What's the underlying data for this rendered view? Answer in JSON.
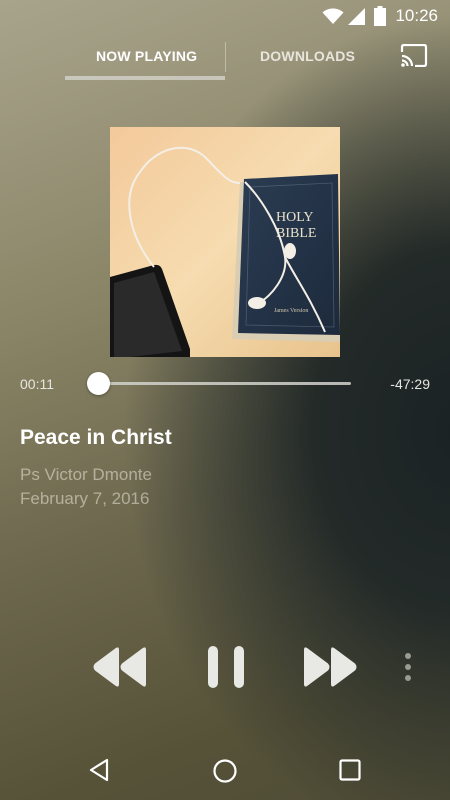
{
  "status_bar": {
    "time": "10:26",
    "icons": [
      "wifi-icon",
      "cellular-signal-icon",
      "battery-icon"
    ]
  },
  "tabs": [
    {
      "label": "NOW PLAYING",
      "selected": true
    },
    {
      "label": "DOWNLOADS",
      "selected": false
    }
  ],
  "header_actions": {
    "cast_icon": "cast-icon"
  },
  "album_art": {
    "description_icon": "album-art-image",
    "cover_text": [
      "HOLY",
      "BIBLE"
    ],
    "spine_text": "James Version"
  },
  "player": {
    "elapsed": "00:11",
    "remaining": "-47:29",
    "progress_fraction": 0.004
  },
  "track": {
    "title": "Peace in Christ",
    "artist": "Ps Victor Dmonte",
    "date": "February 7, 2016"
  },
  "controls": [
    "rewind-icon",
    "pause-icon",
    "fast-forward-icon",
    "more-vertical-icon"
  ],
  "nav_bar": [
    "back-icon",
    "home-icon",
    "recents-icon"
  ],
  "colors": {
    "text_primary": "#ffffff",
    "text_secondary": "#ebe6d7",
    "control": "#e8e8e4"
  }
}
